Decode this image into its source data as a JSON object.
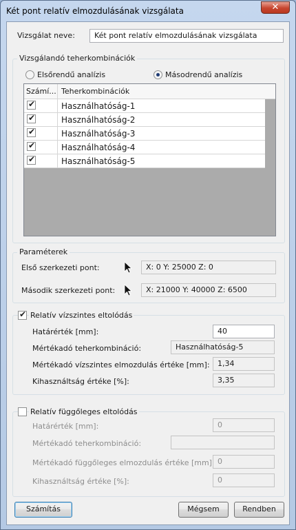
{
  "window": {
    "title": "Két pont relatív elmozdulásának vizsgálata",
    "close_glyph": "✕"
  },
  "name_row": {
    "label": "Vizsgálat neve:",
    "value": "Két pont relatív elmozdulásának vizsgálata"
  },
  "loadcombos": {
    "title": "Vizsgálandó teherkombinációk",
    "radio_first": "Elsőrendű analízis",
    "radio_second": "Másodrendű analízis",
    "selected": "second",
    "col_calc": "Számí...",
    "col_name": "Teherkombinációk",
    "rows": [
      {
        "checked": true,
        "name": "Használhatóság-1"
      },
      {
        "checked": true,
        "name": "Használhatóság-2"
      },
      {
        "checked": true,
        "name": "Használhatóság-3"
      },
      {
        "checked": true,
        "name": "Használhatóság-4"
      },
      {
        "checked": true,
        "name": "Használhatóság-5"
      }
    ]
  },
  "params": {
    "title": "Paraméterek",
    "first_label": "Első szerkezeti pont:",
    "first_value": "X: 0  Y: 25000  Z: 0",
    "second_label": "Második szerkezeti pont:",
    "second_value": "X: 21000  Y: 40000  Z: 6500"
  },
  "horizontal": {
    "enabled": true,
    "title": "Relatív vízszintes eltolódás",
    "limit_label": "Határérték [mm]:",
    "limit_value": "40",
    "combo_label": "Mértékadó teherkombináció:",
    "combo_value": "Használhatóság-5",
    "disp_label": "Mértékadó vízszintes elmozdulás értéke [mm]:",
    "disp_value": "1,34",
    "util_label": "Kihasználtság értéke [%]:",
    "util_value": "3,35"
  },
  "vertical": {
    "enabled": false,
    "title": "Relatív függőleges eltolódás",
    "limit_label": "Határérték [mm]:",
    "limit_value": "0",
    "combo_label": "Mértékadó teherkombináció:",
    "combo_value": "",
    "disp_label": "Mértékadó függőleges elmozdulás értéke [mm]:",
    "disp_value": "0",
    "util_label": "Kihasználtság értéke [%]:",
    "util_value": "0"
  },
  "buttons": {
    "calc": "Számítás",
    "cancel": "Mégsem",
    "ok": "Rendben"
  },
  "icons": {
    "check": "✔",
    "pick_cursor": "arrow-cursor-icon"
  }
}
